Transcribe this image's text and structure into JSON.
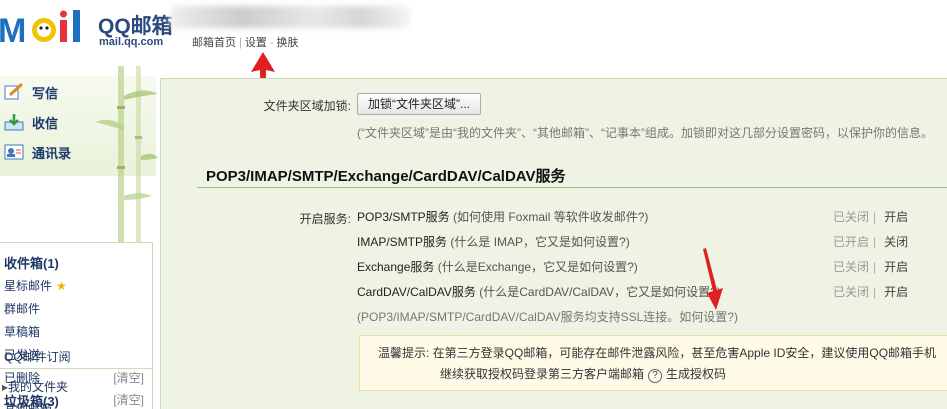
{
  "header": {
    "logo_word": "QQ邮箱",
    "logo_domain": "mail.qq.com",
    "links": [
      "邮箱首页",
      "设置",
      "换肤"
    ]
  },
  "sidebar": {
    "nav": [
      {
        "label": "写信",
        "icon": "compose-icon"
      },
      {
        "label": "收信",
        "icon": "inbox-download-icon"
      },
      {
        "label": "通讯录",
        "icon": "contacts-icon"
      }
    ],
    "folders": [
      {
        "label": "收件箱(1)",
        "bold": true
      },
      {
        "label": "星标邮件",
        "star": "★"
      },
      {
        "label": "群邮件"
      },
      {
        "label": "草稿箱"
      },
      {
        "label": "已发送"
      },
      {
        "label": "已删除",
        "clear": "[清空]"
      },
      {
        "label": "垃圾箱(3)",
        "bold": true,
        "clear": "[清空]"
      },
      {
        "label": "QQ邮件订阅"
      },
      {
        "label": "我的文件夹"
      },
      {
        "label": "其他邮箱"
      }
    ]
  },
  "main": {
    "folder_lock_label": "文件夹区域加锁:",
    "folder_lock_button": "加锁“文件夹区域”...",
    "folder_lock_hint": "(“文件夹区域”是由“我的文件夹”、“其他邮箱”、“记事本”组成。加锁即对这几部分设置密码，以保护你的信息。",
    "section_title": "POP3/IMAP/SMTP/Exchange/CardDAV/CalDAV服务",
    "enable_label": "开启服务:",
    "services": [
      {
        "name": "POP3/SMTP服务",
        "note": "(如何使用 Foxmail 等软件收发邮件?)",
        "status": "已关闭",
        "action": "开启"
      },
      {
        "name": "IMAP/SMTP服务",
        "note": "(什么是 IMAP，它又是如何设置?)",
        "status": "已开启",
        "action": "关闭"
      },
      {
        "name": "Exchange服务",
        "note": "(什么是Exchange，它又是如何设置?)",
        "status": "已关闭",
        "action": "开启"
      },
      {
        "name": "CardDAV/CalDAV服务",
        "note": "(什么是CardDAV/CalDAV，它又是如何设置?)",
        "status": "已关闭",
        "action": "开启"
      }
    ],
    "ssl_note": "(POP3/IMAP/SMTP/CardDAV/CalDAV服务均支持SSL连接。如何设置?)",
    "tip_line1": "温馨提示: 在第三方登录QQ邮箱，可能存在邮件泄露风险，甚至危害Apple ID安全，建议使用QQ邮箱手机",
    "tip_line2_a": "继续获取授权码登录第三方客户端邮箱",
    "tip_line2_q": "?",
    "tip_line2_b": "生成授权码"
  },
  "colors": {
    "main_bg": "#eef3e3",
    "section_line": "#9fbc75",
    "arrow": "#e02020",
    "link_blue": "#1e3764"
  }
}
